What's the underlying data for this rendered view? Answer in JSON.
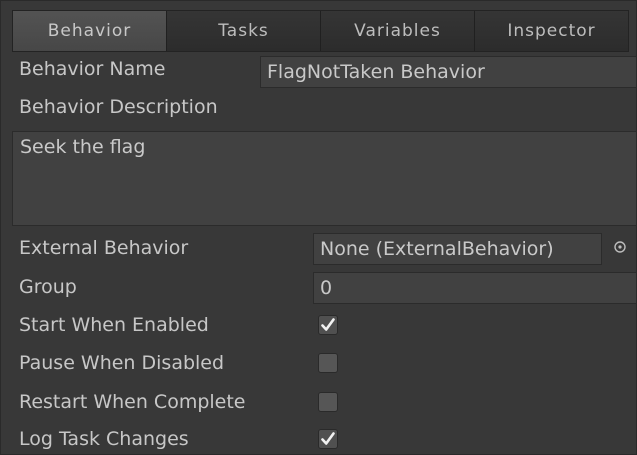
{
  "tabs": [
    {
      "label": "Behavior",
      "active": true
    },
    {
      "label": "Tasks",
      "active": false
    },
    {
      "label": "Variables",
      "active": false
    },
    {
      "label": "Inspector",
      "active": false
    }
  ],
  "behavior_name": {
    "label": "Behavior Name",
    "value": "FlagNotTaken Behavior"
  },
  "behavior_description": {
    "label": "Behavior Description",
    "value": "Seek the flag"
  },
  "external_behavior": {
    "label": "External Behavior",
    "value": "None (ExternalBehavior)",
    "picker_icon": "object-picker-icon"
  },
  "group": {
    "label": "Group",
    "value": "0"
  },
  "start_when_enabled": {
    "label": "Start When Enabled",
    "checked": true
  },
  "pause_when_disabled": {
    "label": "Pause When Disabled",
    "checked": false
  },
  "restart_when_complete": {
    "label": "Restart When Complete",
    "checked": false
  },
  "log_task_changes": {
    "label": "Log Task Changes",
    "checked": true
  },
  "colors": {
    "background": "#383838",
    "field_background": "#414141",
    "active_tab": "#4d4d4d",
    "text": "#c9c9c9"
  }
}
